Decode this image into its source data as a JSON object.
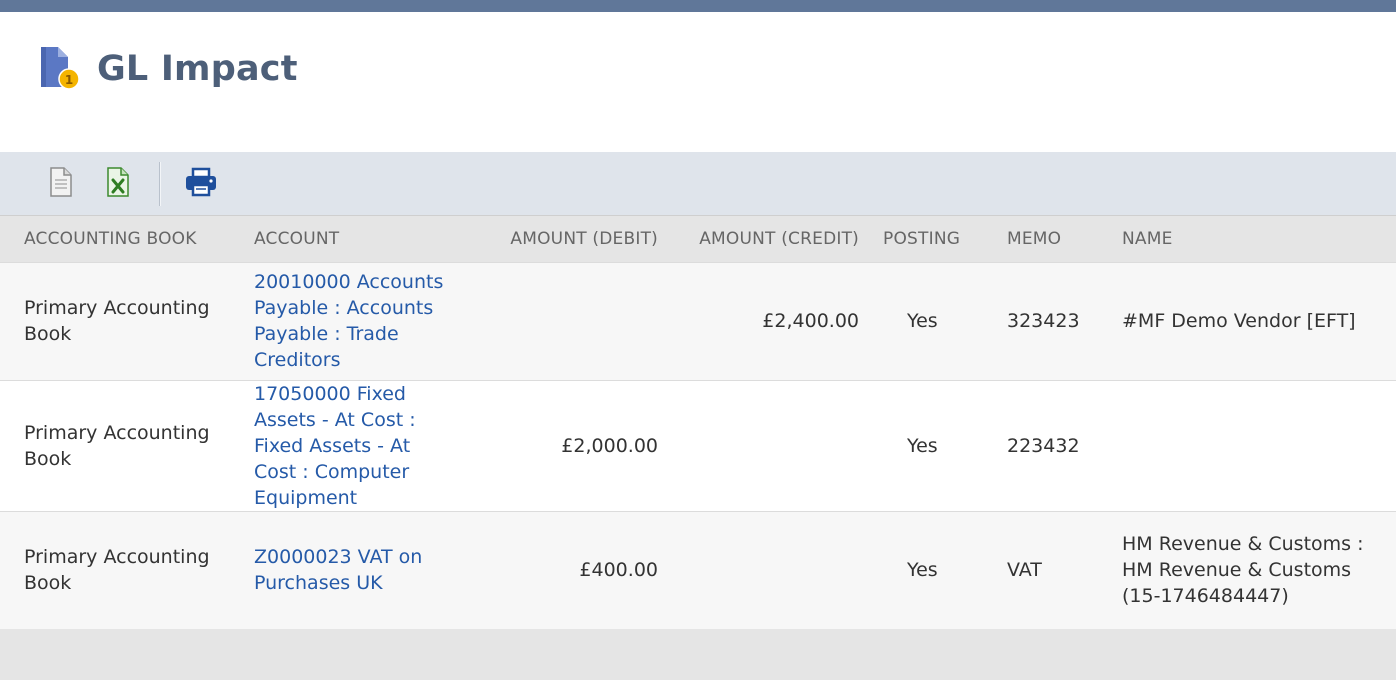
{
  "page": {
    "title": "GL Impact",
    "icon": "gl-impact-document-coin-icon"
  },
  "toolbar": {
    "buttons": [
      {
        "name": "export-csv-button",
        "icon": "document-icon"
      },
      {
        "name": "export-excel-button",
        "icon": "excel-icon"
      },
      {
        "name": "print-button",
        "icon": "printer-icon"
      }
    ]
  },
  "table": {
    "headers": {
      "book": "ACCOUNTING BOOK",
      "account": "ACCOUNT",
      "debit": "AMOUNT (DEBIT)",
      "credit": "AMOUNT (CREDIT)",
      "posting": "POSTING",
      "memo": "MEMO",
      "name": "NAME"
    },
    "rows": [
      {
        "book": "Primary Accounting Book",
        "account": "20010000 Accounts Payable : Accounts Payable : Trade Creditors",
        "debit": "",
        "credit": "£2,400.00",
        "posting": "Yes",
        "memo": "323423",
        "name": "#MF Demo Vendor [EFT]"
      },
      {
        "book": "Primary Accounting Book",
        "account": "17050000 Fixed Assets - At Cost : Fixed Assets - At Cost : Computer Equipment",
        "debit": "£2,000.00",
        "credit": "",
        "posting": "Yes",
        "memo": "223432",
        "name": ""
      },
      {
        "book": "Primary Accounting Book",
        "account": "Z0000023 VAT on Purchases UK",
        "debit": "£400.00",
        "credit": "",
        "posting": "Yes",
        "memo": "VAT",
        "name": "HM Revenue & Customs : HM Revenue & Customs (15-1746484447)"
      }
    ]
  },
  "colors": {
    "top_bar": "#607799",
    "title": "#4d5f79",
    "toolbar_bg": "#dfe4eb",
    "link": "#255aa8",
    "header_bg": "#e5e5e5"
  }
}
